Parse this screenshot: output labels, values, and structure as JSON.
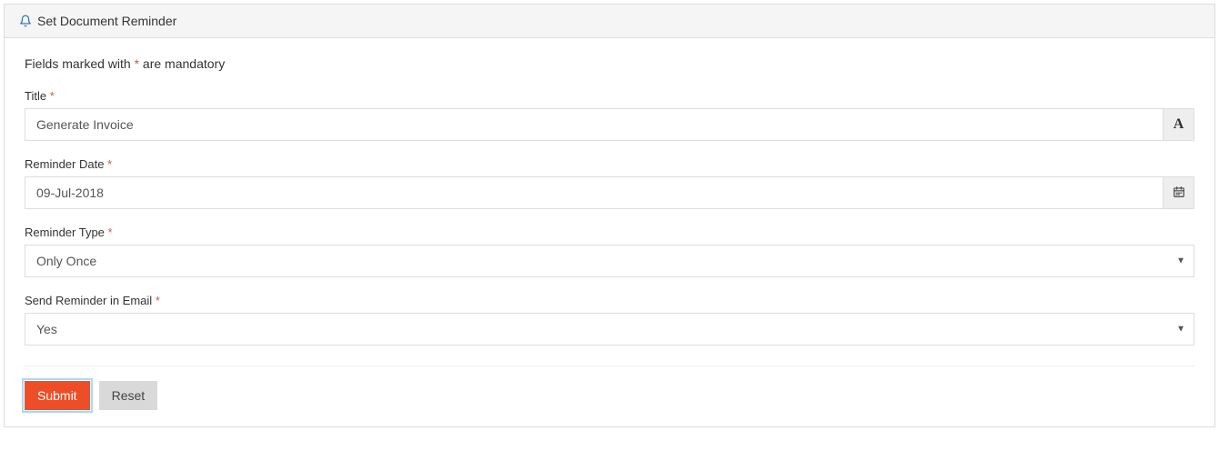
{
  "header": {
    "title": "Set Document Reminder"
  },
  "hint": {
    "prefix": "Fields marked with ",
    "mark": "*",
    "suffix": " are mandatory"
  },
  "fields": {
    "title": {
      "label": "Title",
      "value": "Generate Invoice"
    },
    "reminder_date": {
      "label": "Reminder Date",
      "value": "09-Jul-2018"
    },
    "reminder_type": {
      "label": "Reminder Type",
      "selected": "Only Once"
    },
    "send_email": {
      "label": "Send Reminder in Email",
      "selected": "Yes"
    }
  },
  "buttons": {
    "submit": "Submit",
    "reset": "Reset"
  },
  "symbols": {
    "required": "*"
  }
}
